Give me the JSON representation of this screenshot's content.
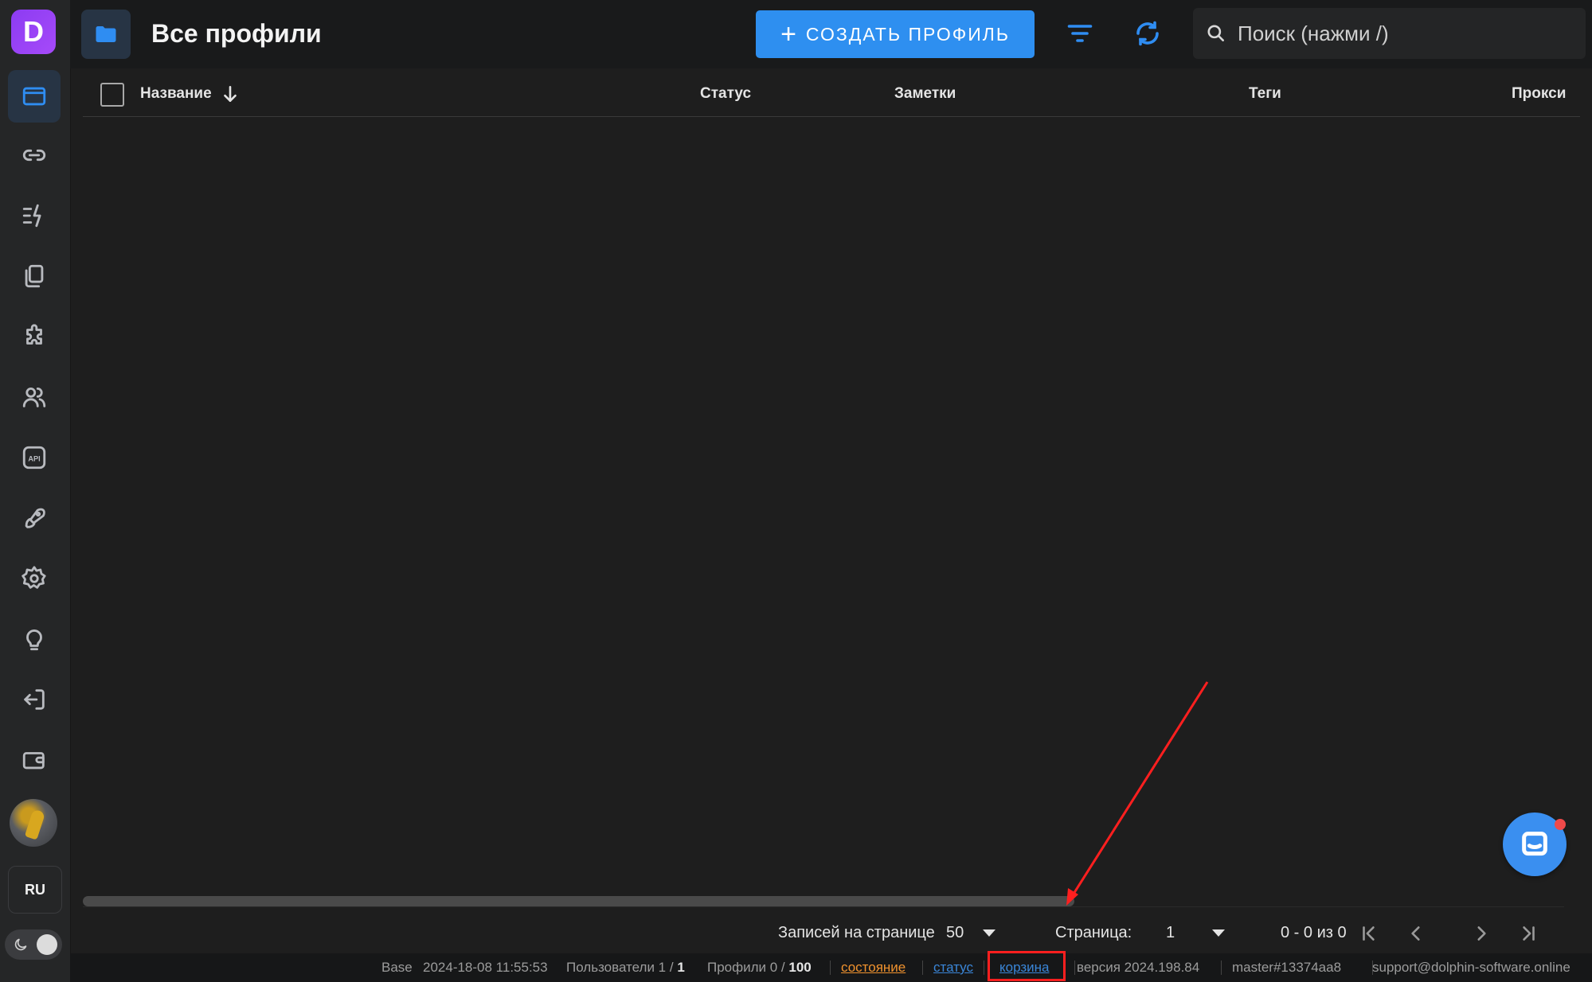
{
  "sidebar": {
    "logo_letter": "D",
    "items": [
      {
        "name": "browser-profiles",
        "icon": "browser-window-icon",
        "active": true
      },
      {
        "name": "links",
        "icon": "link-icon",
        "active": false
      },
      {
        "name": "automation",
        "icon": "lightning-list-icon",
        "active": false
      },
      {
        "name": "copies",
        "icon": "copy-icon",
        "active": false
      },
      {
        "name": "extensions",
        "icon": "puzzle-icon",
        "active": false
      },
      {
        "name": "users",
        "icon": "users-icon",
        "active": false
      },
      {
        "name": "api",
        "icon": "api-icon",
        "active": false
      },
      {
        "name": "launch",
        "icon": "rocket-icon",
        "active": false
      },
      {
        "name": "settings",
        "icon": "gear-icon",
        "active": false
      },
      {
        "name": "tips",
        "icon": "lightbulb-icon",
        "active": false
      },
      {
        "name": "logout",
        "icon": "logout-icon",
        "active": false
      },
      {
        "name": "wallet",
        "icon": "wallet-icon",
        "active": false
      }
    ],
    "language": "RU",
    "api_icon_text": "API"
  },
  "header": {
    "title": "Все профили",
    "create_button": "СОЗДАТЬ ПРОФИЛЬ",
    "search_placeholder": "Поиск (нажми /)"
  },
  "table": {
    "columns": [
      "Название",
      "Статус",
      "Заметки",
      "Теги",
      "Прокси"
    ],
    "rows": []
  },
  "pagination": {
    "rows_per_page_label": "Записей на странице",
    "rows_per_page_value": "50",
    "page_label": "Страница:",
    "page_value": "1",
    "range": "0 - 0 из 0"
  },
  "statusbar": {
    "base": "Base",
    "datetime": "2024-18-08 11:55:53",
    "users_label": "Пользователи 1 / ",
    "users_total": "1",
    "profiles_label": "Профили 0 / ",
    "profiles_total": "100",
    "state_link": "состояние",
    "status_link": "статус",
    "trash_link": "корзина",
    "version": "версия 2024.198.84",
    "build": "master#13374aa8",
    "support": "support@dolphin-software.online"
  },
  "colors": {
    "accent": "#2e8ff0",
    "annotation": "#ff1f1f",
    "logo": "#9a44f6"
  }
}
